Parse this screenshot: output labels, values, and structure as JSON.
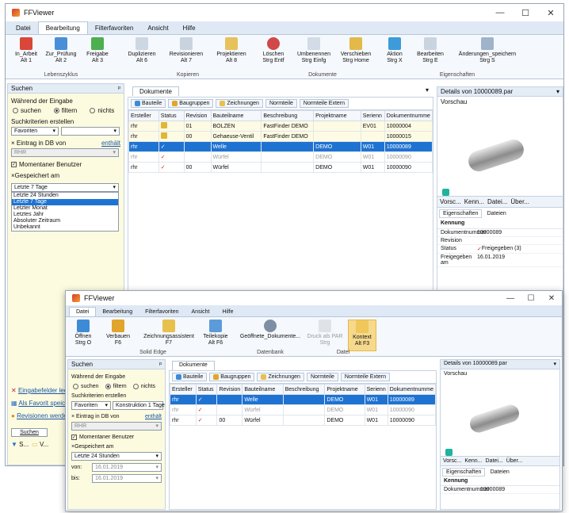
{
  "back": {
    "title": "FFViewer",
    "win_controls": {
      "minimize": "—",
      "maximize": "☐",
      "close": "✕"
    },
    "ribbon_tabs": [
      "Datei",
      "Bearbeitung",
      "Filterfavoriten",
      "Ansicht",
      "Hilfe"
    ],
    "ribbon_groups": [
      "Lebenszyklus",
      "Kopieren",
      "Dokumente",
      "Eigenschaften"
    ],
    "ribbon_buttons": [
      {
        "label": "In_Arbeit",
        "key": "Alt 1"
      },
      {
        "label": "Zur_Prüfung",
        "key": "Alt 2"
      },
      {
        "label": "Freigabe",
        "key": "Alt 3"
      },
      {
        "label": "Duplizieren",
        "key": "Alt 6"
      },
      {
        "label": "Revisionieren",
        "key": "Alt 7"
      },
      {
        "label": "Projektieren",
        "key": "Alt 8"
      },
      {
        "label": "Löschen",
        "key": "Strg Entf"
      },
      {
        "label": "Umbenennen",
        "key": "Strg Einfg"
      },
      {
        "label": "Verschieben",
        "key": "Strg Home"
      },
      {
        "label": "Aktion",
        "key": "Strg X"
      },
      {
        "label": "Bearbeiten",
        "key": "Strg E"
      },
      {
        "label": "Änderungen_speichern",
        "key": "Strg S"
      }
    ],
    "search": {
      "header": "Suchen",
      "pin": "ᵖ",
      "during_input": "Während der Eingabe",
      "opt_search": "suchen",
      "opt_filter": "filtern",
      "opt_none": "nichts",
      "create_criteria": "Suchkriterien erstellen",
      "favorites": "Favoriten",
      "entry_label": "Eintrag in DB von",
      "entry_link": "enthält",
      "entry_value": "RHR",
      "current_user": "Momentaner Benutzer",
      "saved_at": "Gespeichert am",
      "selected": "Letzte 7 Tage",
      "options": [
        "Letzte 24 Stunden",
        "Letzte 7 Tage",
        "Letzter Monat",
        "Letztes Jahr",
        "Absoluter Zeitraum",
        "Unbekannt"
      ],
      "link_delete": "Eingabefelder leeren",
      "link_favorite": "Als Favorit speichern",
      "link_revisions": "Revisionen werden",
      "search_button": "Suchen",
      "bottom_tabs": [
        "S...",
        "V...",
        ""
      ]
    },
    "documents": {
      "tab": "Dokumente",
      "buttons": [
        "Bauteile",
        "Baugruppen",
        "Zeichnungen",
        "Normteile",
        "Normteile Extern"
      ],
      "columns": [
        "Ersteller",
        "Status",
        "Revision",
        "Bauteilname",
        "Beschreibung",
        "Projektname",
        "Serienn",
        "Dokumentnumme"
      ],
      "rows": [
        {
          "creator": "rhr",
          "status": "locked",
          "rev": "01",
          "name": "BOLZEN",
          "desc": "FastFinder DEMO",
          "project": "",
          "series": "EV01",
          "doc": "10000004",
          "style": "yellow"
        },
        {
          "creator": "rhr",
          "status": "locked",
          "rev": "00",
          "name": "Gehaeuse-Ventil",
          "desc": "FastFinder DEMO",
          "project": "",
          "series": "",
          "doc": "10000015",
          "style": "yellow"
        },
        {
          "creator": "rhr",
          "status": "released",
          "rev": "",
          "name": "Welle",
          "desc": "",
          "project": "DEMO",
          "series": "W01",
          "doc": "10000089",
          "style": "sel"
        },
        {
          "creator": "rhr",
          "status": "released",
          "rev": "",
          "name": "Würfel",
          "desc": "",
          "project": "DEMO",
          "series": "W01",
          "doc": "10000090",
          "style": "gray"
        },
        {
          "creator": "rhr",
          "status": "released",
          "rev": "00",
          "name": "Würfel",
          "desc": "",
          "project": "DEMO",
          "series": "W01",
          "doc": "10000090",
          "style": "normal"
        }
      ]
    },
    "details": {
      "title": "Details von 10000089.par",
      "preview": "Vorschau",
      "tabs": [
        "Vorsc...",
        "Kenn...",
        "Datei...",
        "Über..."
      ],
      "props_tabs": [
        "Eigenschaften",
        "Dateien"
      ],
      "section": "Kennung",
      "props": [
        {
          "k": "Dokumentnummer",
          "v": "10000089"
        },
        {
          "k": "Revision",
          "v": ""
        },
        {
          "k": "Status",
          "v": "Freigegeben (3)"
        },
        {
          "k": "Freigegeben am",
          "v": "16.01.2019"
        }
      ]
    }
  },
  "front": {
    "title": "FFViewer",
    "win_controls": {
      "minimize": "—",
      "maximize": "☐",
      "close": "✕"
    },
    "ribbon_tabs": [
      "Datei",
      "Bearbeitung",
      "Filterfavoriten",
      "Ansicht",
      "Hilfe"
    ],
    "ribbon_groups": [
      "Solid Edge",
      "Datenbank",
      "Datei"
    ],
    "ribbon_buttons": [
      {
        "label": "Öffnen",
        "key": "Strg O"
      },
      {
        "label": "Verbauen",
        "key": "F6"
      },
      {
        "label": "Zeichnungsassistent",
        "key": "F7"
      },
      {
        "label": "Teilekopie",
        "key": "Alt F6"
      },
      {
        "label": "Geöffnete_Dokumente...",
        "key": ""
      },
      {
        "label": "Druck als PAR",
        "key": "Strg"
      },
      {
        "label": "Kontext",
        "key": "Alt F3"
      }
    ],
    "search": {
      "header": "Suchen",
      "during_input": "Während der Eingabe",
      "opt_search": "suchen",
      "opt_filter": "filtern",
      "opt_none": "nichts",
      "create_criteria": "Suchkriterien erstellen",
      "favorites": "Favoriten",
      "construction": "Konstruktion 1 Tage",
      "entry_label": "Eintrag in DB von",
      "entry_link": "enthält",
      "entry_value": "RHR",
      "current_user": "Momentaner Benutzer",
      "saved_at": "Gespeichert am",
      "selected": "Letzte 24 Stunden",
      "from_label": "von:",
      "from_date": "16.01.2019",
      "to_label": "bis:",
      "to_date": "16.01.2019"
    },
    "documents": {
      "tab": "Dokumente",
      "buttons": [
        "Bauteile",
        "Baugruppen",
        "Zeichnungen",
        "Normteile",
        "Normteile Extern"
      ],
      "columns": [
        "Ersteller",
        "Status",
        "Revision",
        "Bauteilname",
        "Beschreibung",
        "Projektname",
        "Serienn",
        "Dokumentnumme"
      ],
      "rows": [
        {
          "creator": "rhr",
          "status": "released",
          "rev": "",
          "name": "Welle",
          "desc": "",
          "project": "DEMO",
          "series": "W01",
          "doc": "10000089",
          "style": "sel"
        },
        {
          "creator": "rhr",
          "status": "released",
          "rev": "",
          "name": "Würfel",
          "desc": "",
          "project": "DEMO",
          "series": "W01",
          "doc": "10000090",
          "style": "gray"
        },
        {
          "creator": "rhr",
          "status": "released",
          "rev": "00",
          "name": "Würfel",
          "desc": "",
          "project": "DEMO",
          "series": "W01",
          "doc": "10000090",
          "style": "normal"
        }
      ]
    },
    "details": {
      "title": "Details von 10000089.par",
      "preview": "Vorschau",
      "tabs": [
        "Vorsc...",
        "Kenn...",
        "Datei...",
        "Über..."
      ],
      "props_tabs": [
        "Eigenschaften",
        "Dateien"
      ],
      "section": "Kennung",
      "props": [
        {
          "k": "Dokumentnummer",
          "v": "10000089"
        }
      ]
    }
  },
  "colors": {
    "accent": "#1e73d2",
    "ribbon_bg": "#dfe9f5",
    "panel_yellow": "#fcfbdf",
    "released": "#d62020"
  }
}
